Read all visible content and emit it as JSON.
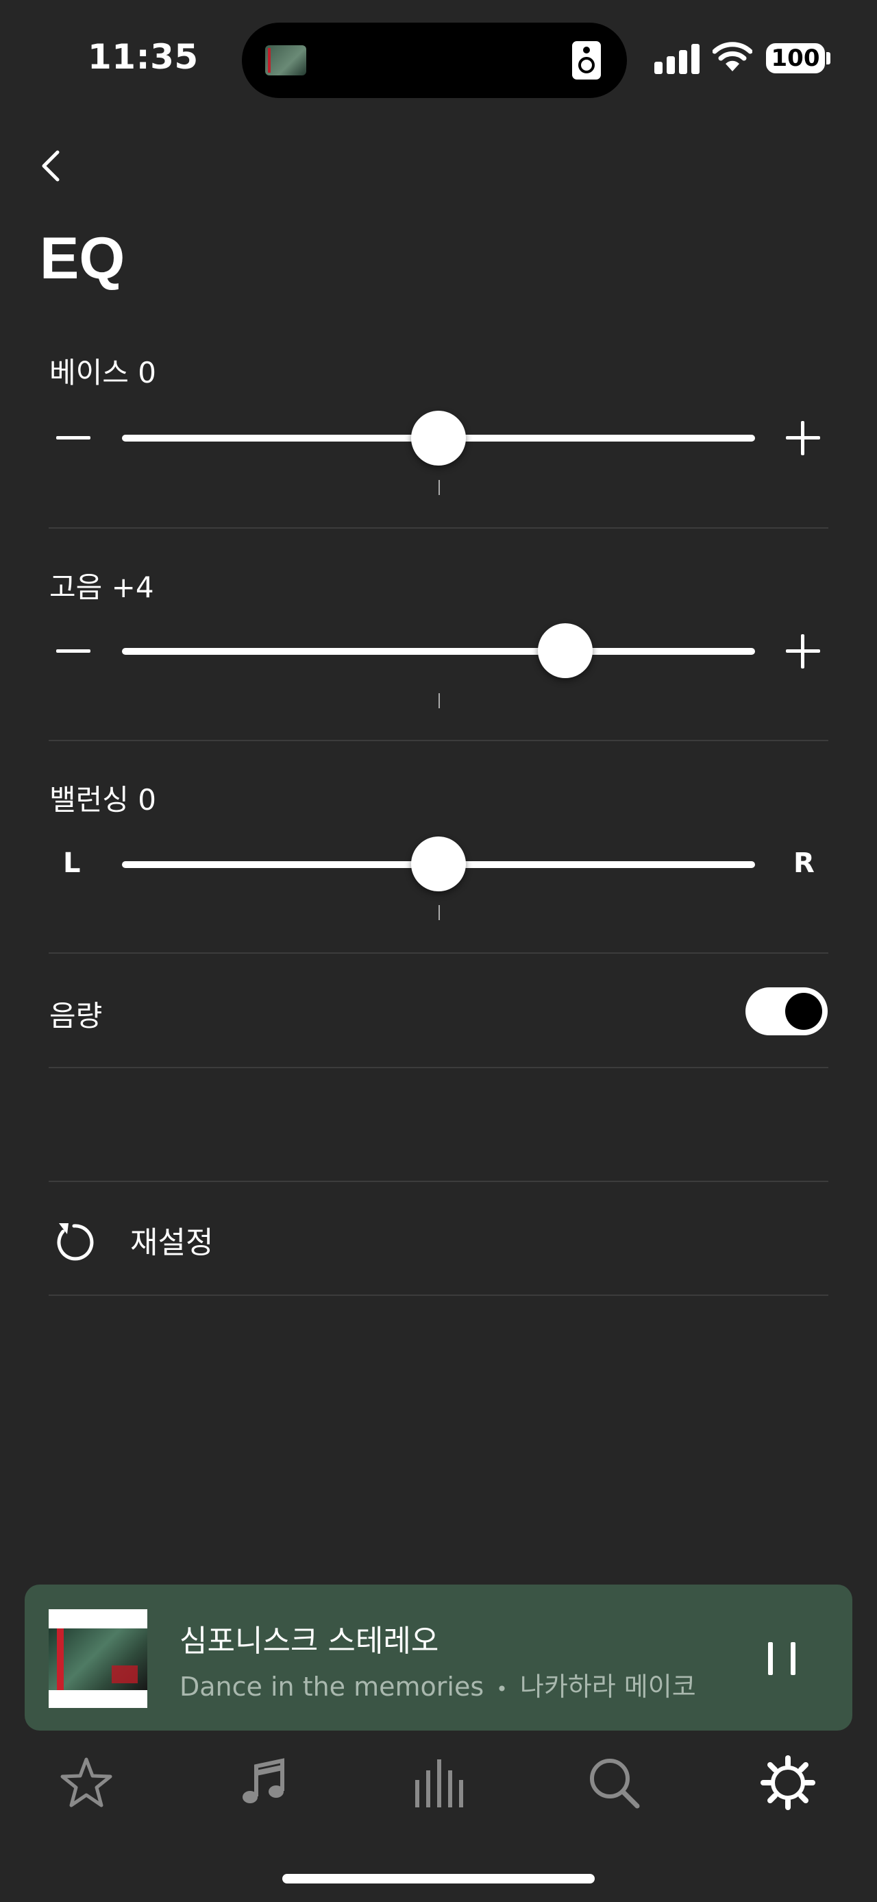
{
  "status": {
    "time": "11:35",
    "battery": "100"
  },
  "page": {
    "title": "EQ"
  },
  "bass": {
    "label": "베이스 0",
    "value": 0,
    "min": -10,
    "max": 10
  },
  "treble": {
    "label": "고음 +4",
    "value": 4,
    "min": -10,
    "max": 10
  },
  "balance": {
    "label": "밸런싱 0",
    "value": 0,
    "min": -10,
    "max": 10,
    "left": "L",
    "right": "R"
  },
  "loudness": {
    "label": "음량",
    "on": true
  },
  "reset": {
    "label": "재설정"
  },
  "now_playing": {
    "room": "심포니스크 스테레오",
    "track": "Dance in the memories",
    "separator": "•",
    "artist": "나카하라 메이코"
  },
  "tabs": [
    {
      "icon": "star-icon",
      "active": false
    },
    {
      "icon": "music-note-icon",
      "active": false
    },
    {
      "icon": "rooms-bars-icon",
      "active": false
    },
    {
      "icon": "search-icon",
      "active": false
    },
    {
      "icon": "gear-icon",
      "active": true
    }
  ],
  "colors": {
    "background": "#262626",
    "player": "#3b5545",
    "divider": "#3c3c3c",
    "inactive_tab": "#8a8a8a"
  }
}
